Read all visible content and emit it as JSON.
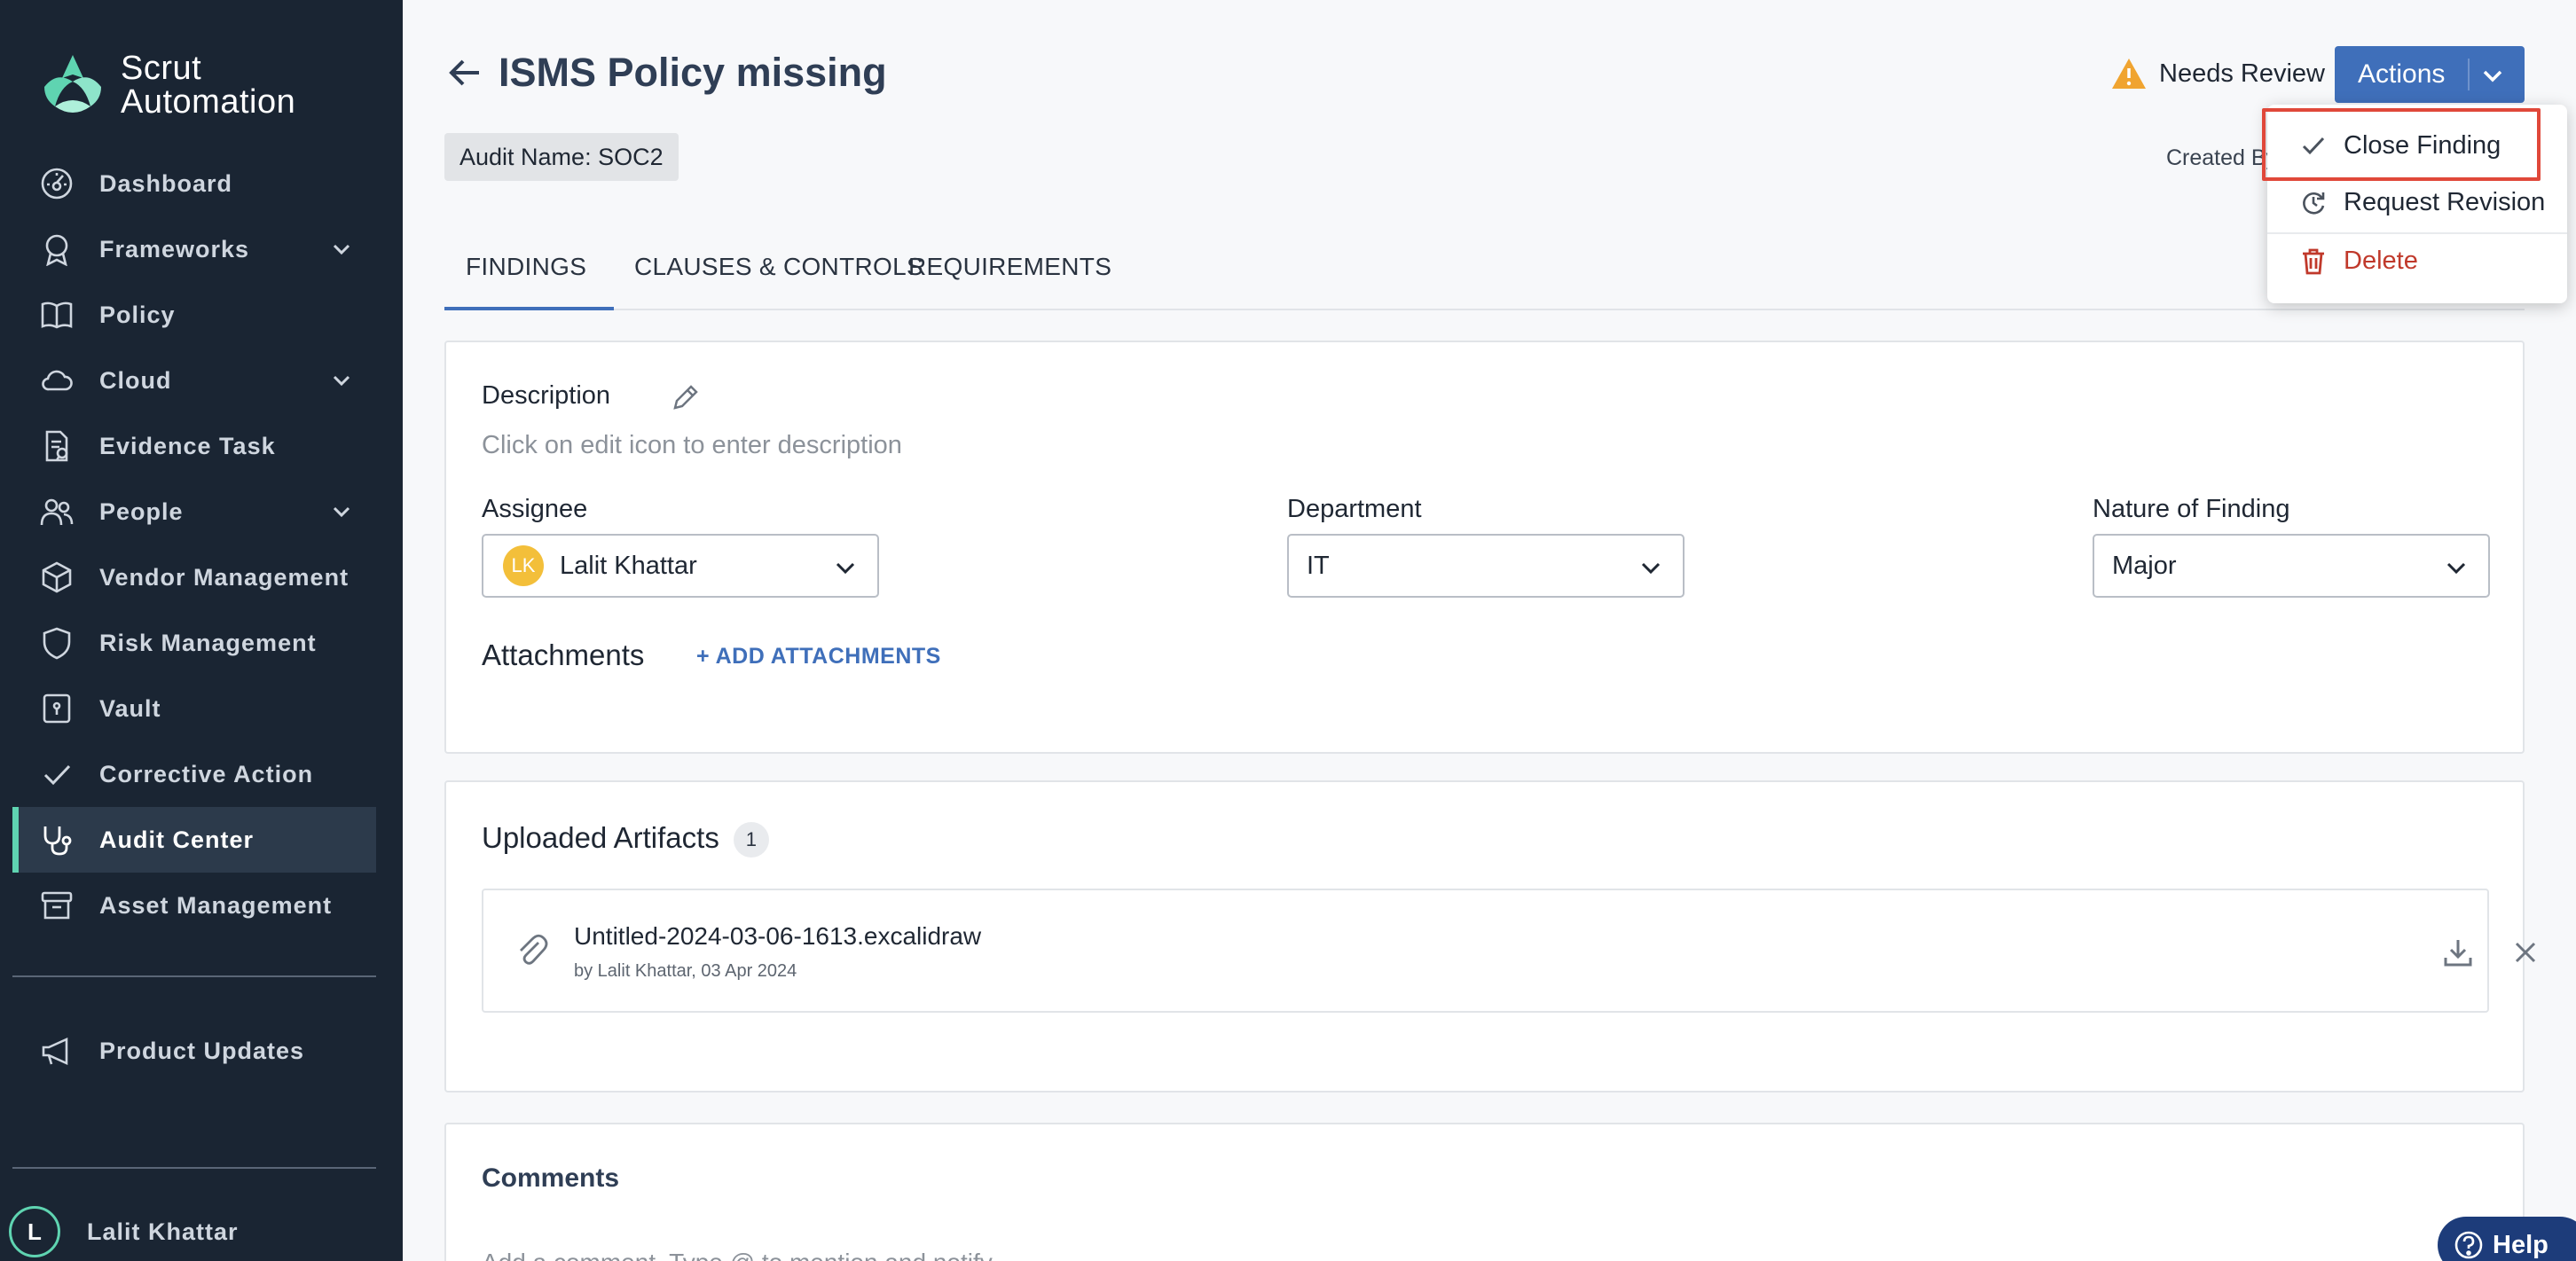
{
  "brand": {
    "line1": "Scrut",
    "line2": "Automation",
    "accent": "#5fd4b1"
  },
  "sidebar": {
    "items": [
      {
        "label": "Dashboard",
        "icon": "dashboard-icon",
        "expandable": false
      },
      {
        "label": "Frameworks",
        "icon": "award-icon",
        "expandable": true
      },
      {
        "label": "Policy",
        "icon": "book-icon",
        "expandable": false
      },
      {
        "label": "Cloud",
        "icon": "cloud-icon",
        "expandable": true
      },
      {
        "label": "Evidence Task",
        "icon": "evidence-icon",
        "expandable": false
      },
      {
        "label": "People",
        "icon": "people-icon",
        "expandable": true
      },
      {
        "label": "Vendor Management",
        "icon": "box-icon",
        "expandable": false
      },
      {
        "label": "Risk Management",
        "icon": "shield-icon",
        "expandable": false
      },
      {
        "label": "Vault",
        "icon": "vault-icon",
        "expandable": false
      },
      {
        "label": "Corrective Action",
        "icon": "check-icon",
        "expandable": false
      },
      {
        "label": "Audit Center",
        "icon": "stethoscope-icon",
        "expandable": false,
        "active": true
      },
      {
        "label": "Asset Management",
        "icon": "archive-icon",
        "expandable": false
      }
    ],
    "secondary": [
      {
        "label": "Product Updates",
        "icon": "megaphone-icon"
      }
    ],
    "user": {
      "initial": "L",
      "name": "Lalit Khattar"
    }
  },
  "header": {
    "title": "ISMS Policy missing",
    "audit_chip": "Audit Name: SOC2",
    "status": "Needs Review",
    "actions_label": "Actions",
    "created_by": "Created By"
  },
  "tabs": [
    {
      "label": "FINDINGS",
      "active": true
    },
    {
      "label": "CLAUSES & CONTROLS",
      "active": false
    },
    {
      "label": "REQUIREMENTS",
      "active": false
    }
  ],
  "details": {
    "description_label": "Description",
    "description_placeholder": "Click on edit icon to enter description",
    "assignee_label": "Assignee",
    "assignee_initials": "LK",
    "assignee_value": "Lalit Khattar",
    "department_label": "Department",
    "department_value": "IT",
    "nature_label": "Nature of Finding",
    "nature_value": "Major",
    "attachments_label": "Attachments",
    "add_attachments_label": "+ ADD ATTACHMENTS"
  },
  "artifacts": {
    "title": "Uploaded Artifacts",
    "count": "1",
    "items": [
      {
        "name": "Untitled-2024-03-06-1613.excalidraw",
        "meta": "by Lalit Khattar, 03 Apr 2024"
      }
    ]
  },
  "comments": {
    "title": "Comments",
    "placeholder": "Add a comment. Type @ to mention and notify"
  },
  "actions_menu": [
    {
      "label": "Close Finding",
      "icon": "check-icon",
      "highlighted": true
    },
    {
      "label": "Request Revision",
      "icon": "revision-icon"
    },
    {
      "label": "Delete",
      "icon": "trash-icon",
      "danger": true
    }
  ],
  "help": {
    "label": "Help"
  },
  "colors": {
    "sidebar_bg": "#1a2533",
    "primary": "#3f6fba",
    "warning": "#f0a430",
    "danger": "#c0392b",
    "highlight_box": "#e0483a"
  }
}
